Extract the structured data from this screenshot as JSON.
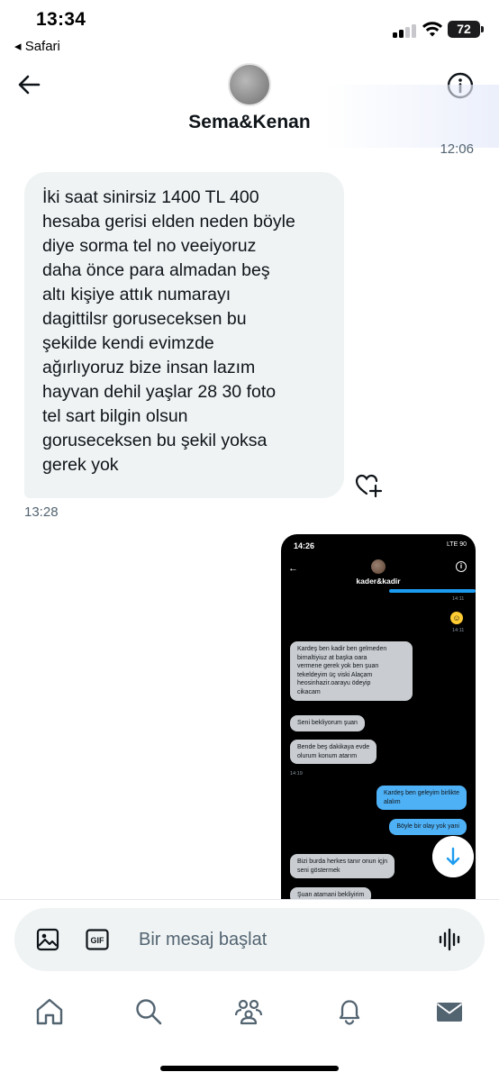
{
  "status_bar": {
    "time": "13:34",
    "back_app": "◂ Safari",
    "battery": "72"
  },
  "header": {
    "contact_name": "Sema&Kenan",
    "back_icon": "arrow-left-icon",
    "info_icon": "info-icon"
  },
  "conversation": {
    "top_timestamp": "12:06",
    "received_message": {
      "text": "İki saat sinirsiz 1400 TL 400\nhesaba gerisi elden neden böyle\ndiye sorma tel no veeiyoruz\ndaha önce para almadan beş\naltı kişiye attık numarayı\ndagittilsr goruseceksen bu\nşekilde kendi evimzde\nağırlıyoruz bize insan lazım\nhayvan dehil yaşlar 28 30 foto\ntel sart  bilgin olsun\ngoruseceksen bu şekil yoksa\ngerek yok",
      "time": "13:28",
      "reaction_icon": "heart-plus-icon"
    },
    "sent_screenshot": {
      "time": "14:26",
      "status": "LTE 90",
      "contact_name": "kader&kadir",
      "ts_1": "14:11",
      "ts_2": "14:11",
      "bubble_1": "Kardeş ben kadir ben gelmeden\nbirnaltiyiuz at başka oara\nvermene gerek yok ben şuan\ntekeldeyim üç viski Alaçam\nheosinhazir.oarayu ödeyip\ncikacam",
      "bubble_2": "Seni bekliyorum şuan",
      "bubble_3": "Bende beş dakikaya evde\nolurum konum atarım",
      "ts_3": "14:19",
      "bubble_4": "Kardeş ben geleyim  birlikte\nalalım",
      "bubble_5": "Böyle bir olay yok yani",
      "bubble_6": "Bizi burda herkes tanır onun içjn\nseni göstermek",
      "bubble_7": "Şuan atamani bekliyirim"
    },
    "scroll_down_icon": "arrow-down-icon"
  },
  "composer": {
    "placeholder": "Bir mesaj başlat",
    "image_icon": "image-icon",
    "gif_icon": "gif-icon",
    "gif_label": "GIF",
    "voice_icon": "voice-wave-icon"
  },
  "bottom_nav": {
    "items": [
      "home-icon",
      "search-icon",
      "communities-icon",
      "notifications-icon",
      "messages-icon"
    ]
  },
  "colors": {
    "bubble_in": "#eff3f4",
    "text": "#0f1419",
    "muted": "#536471",
    "accent": "#1d9bf0"
  }
}
